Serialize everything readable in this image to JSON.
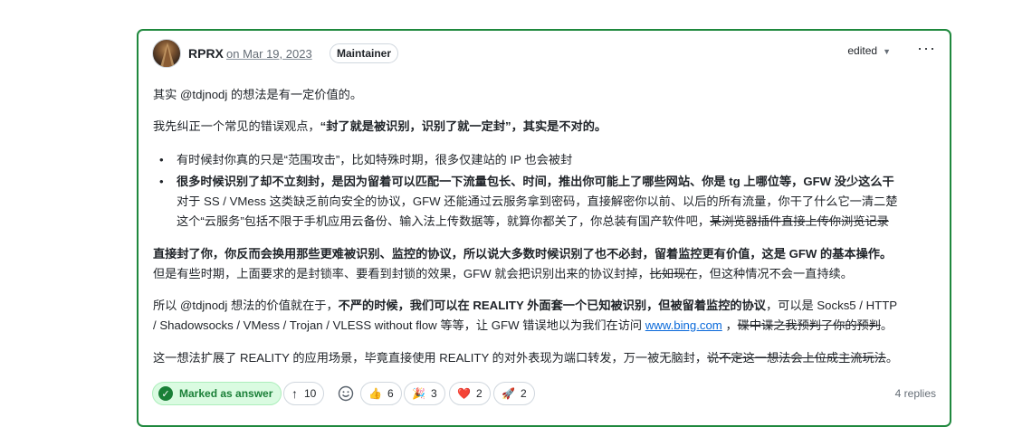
{
  "post": {
    "author": "RPRX",
    "date": "on Mar 19, 2023",
    "badge": "Maintainer",
    "edited": "edited",
    "more": "···"
  },
  "content": {
    "p1": "其实 @tdjnodj 的想法是有一定价值的。",
    "p2_pre": "我先纠正一个常见的错误观点，",
    "p2_bold": "“封了就是被识别，识别了就一定封”，其实是不对的。",
    "li1": "有时候封你真的只是“范围攻击”，比如特殊时期，很多仅建站的 IP 也会被封",
    "li2_bold": "很多时候识别了却不立刻封，是因为留着可以匹配一下流量包长、时间，推出你可能上了哪些网站、你是 tg 上哪位等，GFW 没少这么干",
    "li2_rest": "对于 SS / VMess 这类缺乏前向安全的协议，GFW 还能通过云服务拿到密码，直接解密你以前、以后的所有流量，你干了什么它一清二楚",
    "li2_rest2": "这个“云服务”包括不限于手机应用云备份、输入法上传数据等，就算你都关了，你总装有国产软件吧，",
    "li2_strike": "某浏览器插件直接上传你浏览记录",
    "p4_bold": "直接封了你，你反而会换用那些更难被识别、监控的协议，所以说大多数时候识别了也不必封，留着监控更有价值，这是 GFW 的基本操作。",
    "p4_rest": "但是有些时期，上面要求的是封锁率、要看到封锁的效果，GFW 就会把识别出来的协议封掉，",
    "p4_strike": "比如现在",
    "p4_end": "，但这种情况不会一直持续。",
    "p5_pre": "所以 @tdjnodj 想法的价值就在于，",
    "p5_bold": "不严的时候，我们可以在 REALITY 外面套一个已知被识别，但被留着监控的协议",
    "p5_mid": "，可以是 Socks5 / HTTP",
    "p5_line2": "/ Shadowsocks / VMess / Trojan / VLESS without flow 等等，让 GFW 错误地以为我们在访问 ",
    "p5_link": "www.bing.com",
    "p5_sep": " ，",
    "p5_strike": "碟中谍之我预判了你的预判",
    "p5_end": "。",
    "p6_pre": "这一想法扩展了 REALITY 的应用场景，毕竟直接使用 REALITY 的对外表现为端口转发，万一被无脑封，",
    "p6_strike": "说不定这一想法会上位成主流玩法",
    "p6_end": "。"
  },
  "footer": {
    "answer": "Marked as answer",
    "upvote_arrow": "↑",
    "upvotes": "10",
    "reactions": [
      {
        "emoji": "👍",
        "count": "6"
      },
      {
        "emoji": "🎉",
        "count": "3"
      },
      {
        "emoji": "❤️",
        "count": "2"
      },
      {
        "emoji": "🚀",
        "count": "2"
      }
    ],
    "replies": "4 replies"
  },
  "colors": {
    "border_accent": "#1f883d",
    "answer_green": "#1a7f37",
    "link": "#0969da"
  }
}
